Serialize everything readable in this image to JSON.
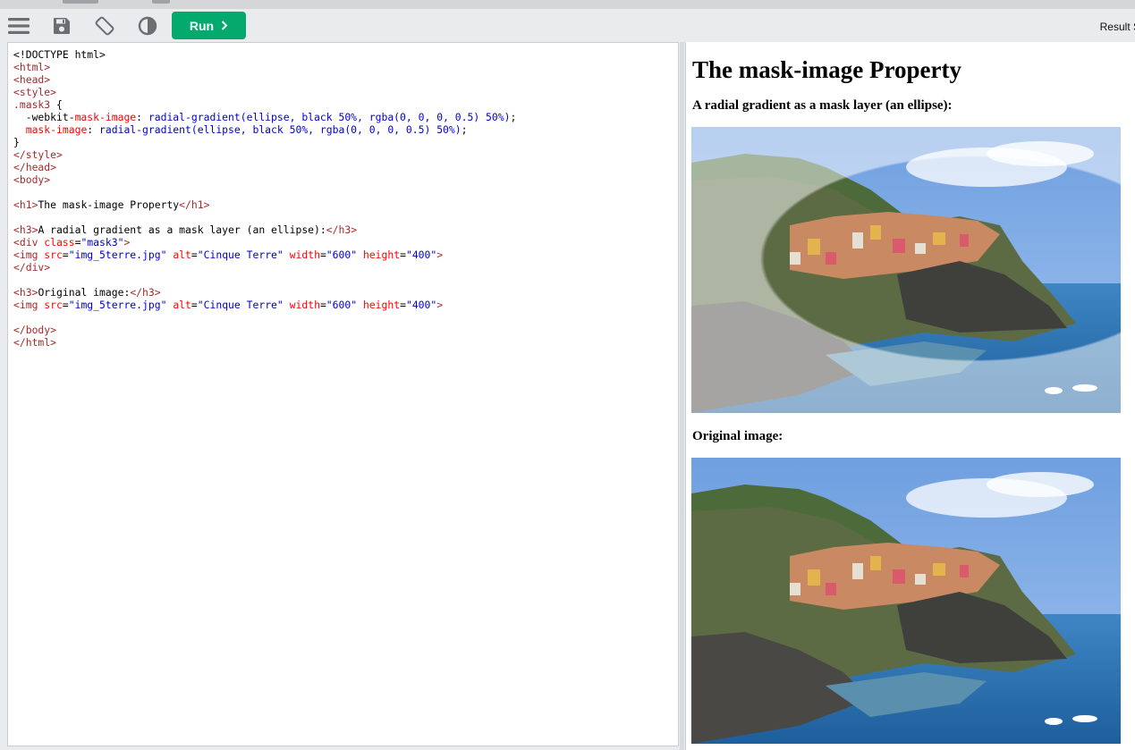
{
  "toolbar": {
    "run_label": "Run",
    "result_label": "Result S"
  },
  "editor": {
    "lines": [
      [
        {
          "t": "plain",
          "s": "<!DOCTYPE html>"
        }
      ],
      [
        {
          "t": "tag",
          "s": "<html>"
        }
      ],
      [
        {
          "t": "tag",
          "s": "<head>"
        }
      ],
      [
        {
          "t": "tag",
          "s": "<style>"
        }
      ],
      [
        {
          "t": "sel",
          "s": ".mask3"
        },
        {
          "t": "plain",
          "s": " {"
        }
      ],
      [
        {
          "t": "plain",
          "s": "  -webkit-"
        },
        {
          "t": "prop",
          "s": "mask-image"
        },
        {
          "t": "plain",
          "s": ": "
        },
        {
          "t": "pval",
          "s": "radial-gradient(ellipse, black 50%, rgba(0, 0, 0, 0.5) 50%)"
        },
        {
          "t": "plain",
          "s": ";"
        }
      ],
      [
        {
          "t": "plain",
          "s": "  "
        },
        {
          "t": "prop",
          "s": "mask-image"
        },
        {
          "t": "plain",
          "s": ": "
        },
        {
          "t": "pval",
          "s": "radial-gradient(ellipse, black 50%, rgba(0, 0, 0, 0.5) 50%)"
        },
        {
          "t": "plain",
          "s": ";"
        }
      ],
      [
        {
          "t": "plain",
          "s": "}"
        }
      ],
      [
        {
          "t": "tag",
          "s": "</style>"
        }
      ],
      [
        {
          "t": "tag",
          "s": "</head>"
        }
      ],
      [
        {
          "t": "tag",
          "s": "<body>"
        }
      ],
      [],
      [
        {
          "t": "tag",
          "s": "<h1>"
        },
        {
          "t": "plain",
          "s": "The mask-image Property"
        },
        {
          "t": "tag",
          "s": "</h1>"
        }
      ],
      [],
      [
        {
          "t": "tag",
          "s": "<h3>"
        },
        {
          "t": "plain",
          "s": "A radial gradient as a mask layer (an ellipse):"
        },
        {
          "t": "tag",
          "s": "</h3>"
        }
      ],
      [
        {
          "t": "tag",
          "s": "<div "
        },
        {
          "t": "attr",
          "s": "class"
        },
        {
          "t": "plain",
          "s": "="
        },
        {
          "t": "val",
          "s": "\"mask3\""
        },
        {
          "t": "tag",
          "s": ">"
        }
      ],
      [
        {
          "t": "tag",
          "s": "<img "
        },
        {
          "t": "attr",
          "s": "src"
        },
        {
          "t": "plain",
          "s": "="
        },
        {
          "t": "val",
          "s": "\"img_5terre.jpg\""
        },
        {
          "t": "plain",
          "s": " "
        },
        {
          "t": "attr",
          "s": "alt"
        },
        {
          "t": "plain",
          "s": "="
        },
        {
          "t": "val",
          "s": "\"Cinque Terre\""
        },
        {
          "t": "plain",
          "s": " "
        },
        {
          "t": "attr",
          "s": "width"
        },
        {
          "t": "plain",
          "s": "="
        },
        {
          "t": "val",
          "s": "\"600\""
        },
        {
          "t": "plain",
          "s": " "
        },
        {
          "t": "attr",
          "s": "height"
        },
        {
          "t": "plain",
          "s": "="
        },
        {
          "t": "val",
          "s": "\"400\""
        },
        {
          "t": "tag",
          "s": ">"
        }
      ],
      [
        {
          "t": "tag",
          "s": "</div>"
        }
      ],
      [],
      [
        {
          "t": "tag",
          "s": "<h3>"
        },
        {
          "t": "plain",
          "s": "Original image:"
        },
        {
          "t": "tag",
          "s": "</h3>"
        }
      ],
      [
        {
          "t": "tag",
          "s": "<img "
        },
        {
          "t": "attr",
          "s": "src"
        },
        {
          "t": "plain",
          "s": "="
        },
        {
          "t": "val",
          "s": "\"img_5terre.jpg\""
        },
        {
          "t": "plain",
          "s": " "
        },
        {
          "t": "attr",
          "s": "alt"
        },
        {
          "t": "plain",
          "s": "="
        },
        {
          "t": "val",
          "s": "\"Cinque Terre\""
        },
        {
          "t": "plain",
          "s": " "
        },
        {
          "t": "attr",
          "s": "width"
        },
        {
          "t": "plain",
          "s": "="
        },
        {
          "t": "val",
          "s": "\"600\""
        },
        {
          "t": "plain",
          "s": " "
        },
        {
          "t": "attr",
          "s": "height"
        },
        {
          "t": "plain",
          "s": "="
        },
        {
          "t": "val",
          "s": "\"400\""
        },
        {
          "t": "tag",
          "s": ">"
        }
      ],
      [],
      [
        {
          "t": "tag",
          "s": "</body>"
        }
      ],
      [
        {
          "t": "tag",
          "s": "</html>"
        }
      ]
    ]
  },
  "result": {
    "h1": "The mask-image Property",
    "h3_masked": "A radial gradient as a mask layer (an ellipse):",
    "h3_original": "Original image:"
  },
  "colors": {
    "run_button": "#04aa6d",
    "tag": "#a52a2a",
    "attribute": "#ff0000",
    "value": "#0000cd"
  },
  "icons": [
    "menu-icon",
    "save-icon",
    "rotate-icon",
    "contrast-icon",
    "chevron-right-icon"
  ]
}
